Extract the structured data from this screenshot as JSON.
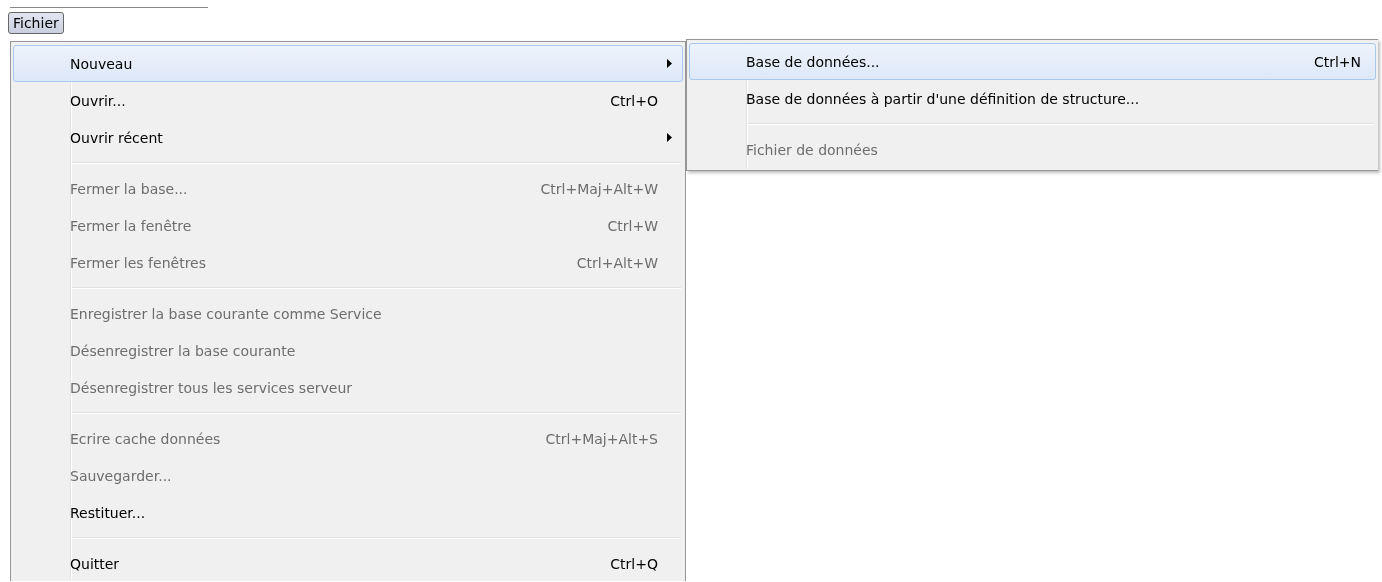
{
  "menubar": [
    {
      "label": "Fichier",
      "selected": true
    }
  ],
  "menu": [
    {
      "kind": "item",
      "label": "Nouveau",
      "selected": true,
      "disabled": false,
      "submenu": true
    },
    {
      "kind": "item",
      "label": "Ouvrir...",
      "shortcut": "Ctrl+O",
      "selected": false,
      "disabled": false,
      "submenu": false
    },
    {
      "kind": "item",
      "label": "Ouvrir récent",
      "selected": false,
      "disabled": false,
      "submenu": true
    },
    {
      "kind": "separator"
    },
    {
      "kind": "item",
      "label": "Fermer la base...",
      "shortcut": "Ctrl+Maj+Alt+W",
      "selected": false,
      "disabled": true,
      "submenu": false
    },
    {
      "kind": "item",
      "label": "Fermer la fenêtre",
      "shortcut": "Ctrl+W",
      "selected": false,
      "disabled": true,
      "submenu": false
    },
    {
      "kind": "item",
      "label": "Fermer les fenêtres",
      "shortcut": "Ctrl+Alt+W",
      "selected": false,
      "disabled": true,
      "submenu": false
    },
    {
      "kind": "separator"
    },
    {
      "kind": "item",
      "label": "Enregistrer la base courante comme Service",
      "selected": false,
      "disabled": true,
      "submenu": false
    },
    {
      "kind": "item",
      "label": "Désenregistrer la base courante",
      "selected": false,
      "disabled": true,
      "submenu": false
    },
    {
      "kind": "item",
      "label": "Désenregistrer tous les services serveur",
      "selected": false,
      "disabled": true,
      "submenu": false
    },
    {
      "kind": "separator"
    },
    {
      "kind": "item",
      "label": "Ecrire cache données",
      "shortcut": "Ctrl+Maj+Alt+S",
      "selected": false,
      "disabled": true,
      "submenu": false
    },
    {
      "kind": "item",
      "label": "Sauvegarder...",
      "selected": false,
      "disabled": true,
      "submenu": false
    },
    {
      "kind": "item",
      "label": "Restituer...",
      "selected": false,
      "disabled": false,
      "submenu": false
    },
    {
      "kind": "separator"
    },
    {
      "kind": "item",
      "label": "Quitter",
      "shortcut": "Ctrl+Q",
      "selected": false,
      "disabled": false,
      "submenu": false
    }
  ],
  "submenu": [
    {
      "kind": "item",
      "label": "Base de données...",
      "shortcut": "Ctrl+N",
      "selected": true,
      "disabled": false,
      "submenu": false
    },
    {
      "kind": "item",
      "label": "Base de données à partir d'une définition de structure...",
      "selected": false,
      "disabled": false,
      "submenu": false
    },
    {
      "kind": "separator"
    },
    {
      "kind": "item",
      "label": "Fichier de données",
      "selected": false,
      "disabled": true,
      "submenu": false
    }
  ]
}
